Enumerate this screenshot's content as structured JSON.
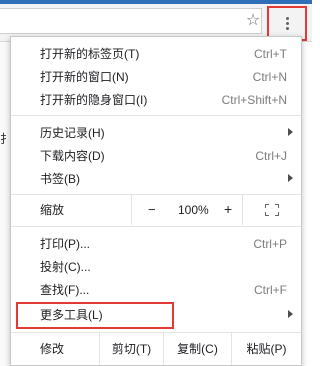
{
  "toolbar": {
    "star_icon": "star-icon",
    "menu_icon": "kebab-menu-icon",
    "highlight_color": "#e53935"
  },
  "page": {
    "partial_text": "扌"
  },
  "menu": {
    "items_top": [
      {
        "label": "打开新的标签页(T)",
        "shortcut": "Ctrl+T"
      },
      {
        "label": "打开新的窗口(N)",
        "shortcut": "Ctrl+N"
      },
      {
        "label": "打开新的隐身窗口(I)",
        "shortcut": "Ctrl+Shift+N"
      }
    ],
    "items_history": [
      {
        "label": "历史记录(H)",
        "shortcut": ""
      },
      {
        "label": "下载内容(D)",
        "shortcut": "Ctrl+J"
      },
      {
        "label": "书签(B)",
        "shortcut": ""
      }
    ],
    "zoom": {
      "label": "缩放",
      "minus": "−",
      "value": "100%",
      "plus": "+"
    },
    "items_tools": [
      {
        "label": "打印(P)...",
        "shortcut": "Ctrl+P"
      },
      {
        "label": "投射(C)...",
        "shortcut": ""
      },
      {
        "label": "查找(F)...",
        "shortcut": "Ctrl+F"
      },
      {
        "label": "更多工具(L)",
        "shortcut": ""
      }
    ],
    "edit": {
      "label": "修改",
      "cut": "剪切(T)",
      "copy": "复制(C)",
      "paste": "粘贴(P)"
    }
  }
}
